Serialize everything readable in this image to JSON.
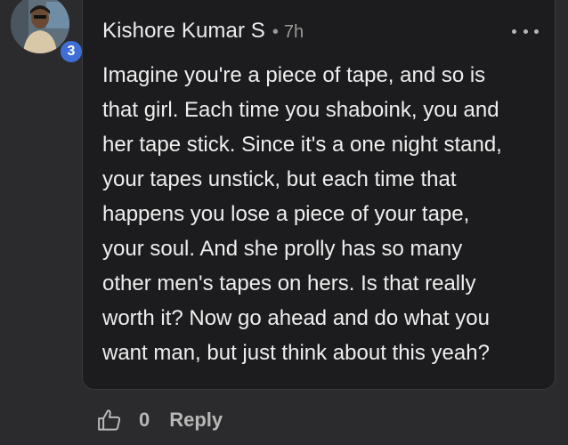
{
  "comment": {
    "author": "Kishore Kumar S",
    "separator": "•",
    "time": "7h",
    "level_badge": "3",
    "body_lines": [
      "Imagine you're a piece of tape, and so is",
      "that girl. Each time you shaboink, you and",
      "her tape stick. Since it's a one night stand,",
      "your tapes unstick, but each time that",
      "happens you lose a piece of your tape,",
      "your soul. And she prolly has so many",
      "other men's tapes on hers. Is that really",
      "worth it? Now go ahead and do what you",
      "want man, but just think about this yeah?"
    ]
  },
  "actions": {
    "like_icon": "thumbs-up-icon",
    "like_count": "0",
    "reply_label": "Reply"
  },
  "colors": {
    "page_background": "#2b2b2d",
    "bubble_background": "#1c1c1e",
    "badge_blue": "#3f6fd6"
  }
}
